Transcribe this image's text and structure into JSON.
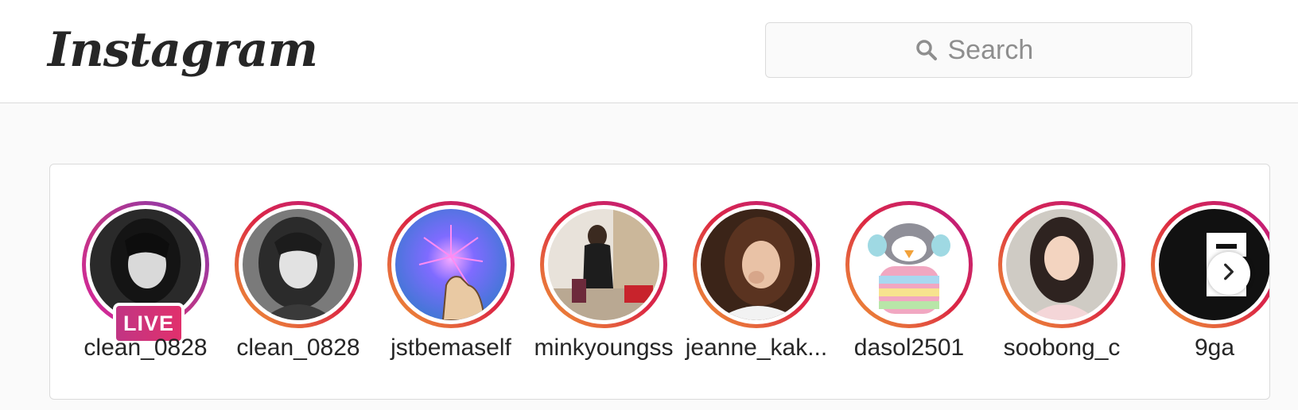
{
  "header": {
    "logo_text": "Instagram",
    "search": {
      "placeholder": "Search",
      "value": ""
    }
  },
  "stories": [
    {
      "username": "clean_0828",
      "live": true,
      "live_label": "LIVE"
    },
    {
      "username": "clean_0828",
      "live": false
    },
    {
      "username": "jstbemaself",
      "live": false
    },
    {
      "username": "minkyoungss",
      "live": false
    },
    {
      "username": "jeanne_kak...",
      "live": false
    },
    {
      "username": "dasol2501",
      "live": false
    },
    {
      "username": "soobong_c",
      "live": false
    },
    {
      "username": "9ga",
      "live": false
    }
  ],
  "colors": {
    "ring_gradient": [
      "#f09433",
      "#e6683c",
      "#dc2743",
      "#cc2366",
      "#bc1888"
    ],
    "live_badge": "#e1306c",
    "border": "#dbdbdb",
    "background": "#fafafa"
  },
  "icons": {
    "search": "search-icon",
    "next": "chevron-right-icon"
  }
}
